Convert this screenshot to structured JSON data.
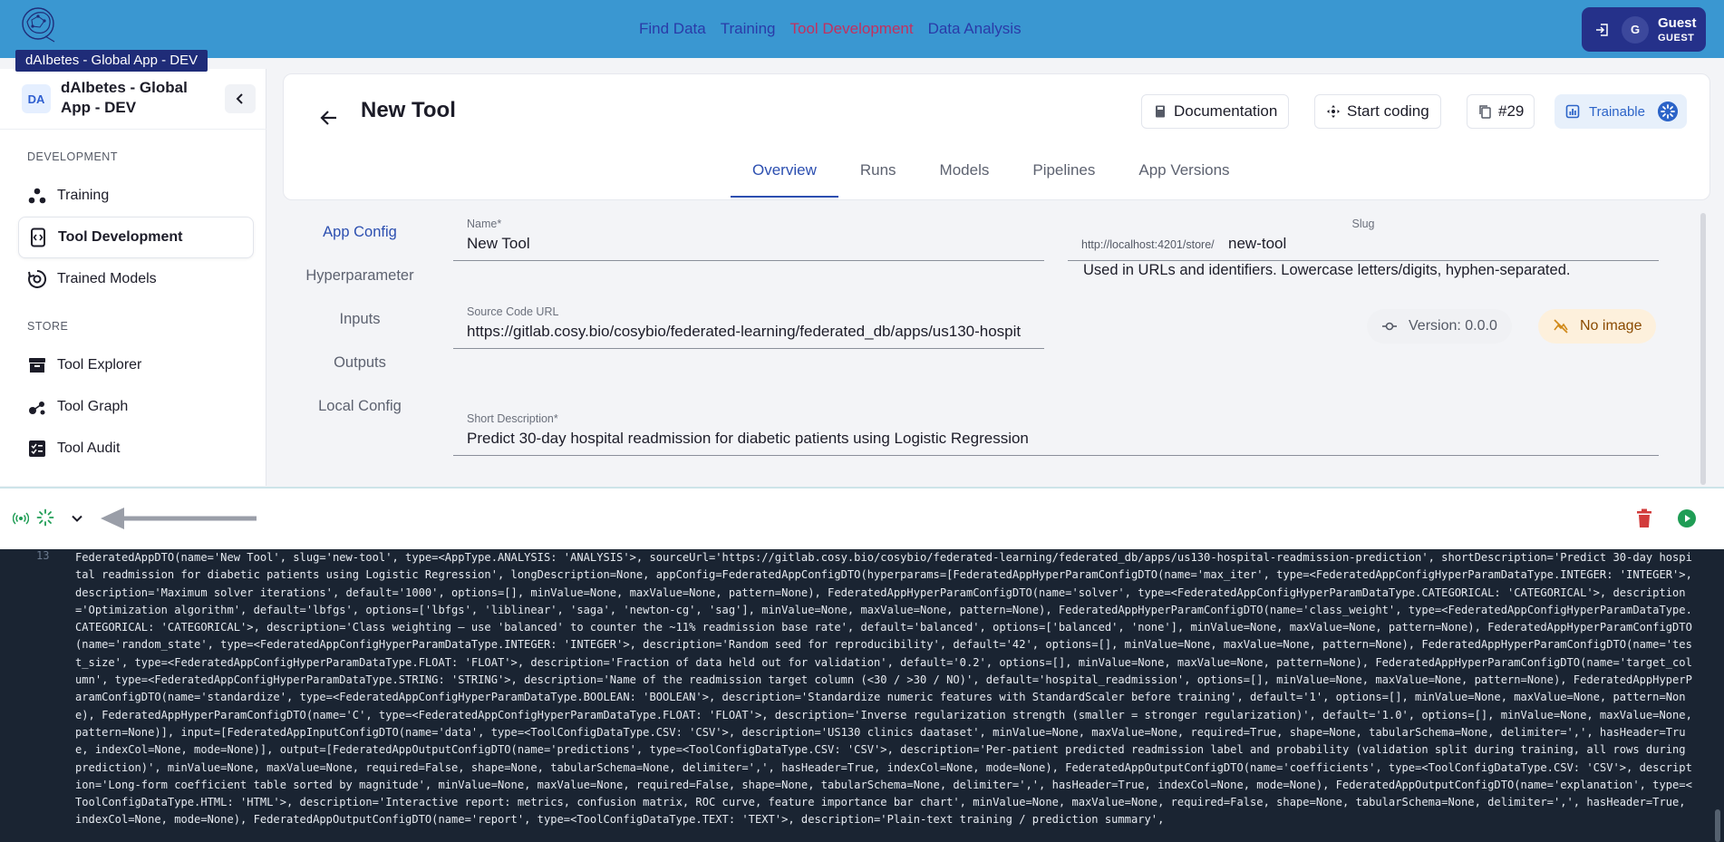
{
  "app": {
    "env_badge": "dAIbetes - Global App - DEV"
  },
  "topnav": [
    {
      "label": "Find Data",
      "active": false
    },
    {
      "label": "Training",
      "active": false
    },
    {
      "label": "Tool Development",
      "active": true
    },
    {
      "label": "Data Analysis",
      "active": false
    }
  ],
  "user": {
    "avatar_initial": "G",
    "name": "Guest",
    "role": "GUEST"
  },
  "sidebar": {
    "badge": "DA",
    "name": "dAIbetes - Global App - DEV",
    "sections": {
      "development": "DEVELOPMENT",
      "store": "STORE"
    },
    "items": [
      {
        "label": "Training",
        "icon": "training-icon"
      },
      {
        "label": "Tool Development",
        "icon": "tool-development-icon",
        "active": true
      },
      {
        "label": "Trained Models",
        "icon": "trained-models-icon"
      },
      {
        "label": "Tool Explorer",
        "icon": "tool-explorer-icon"
      },
      {
        "label": "Tool Graph",
        "icon": "tool-graph-icon"
      },
      {
        "label": "Tool Audit",
        "icon": "tool-audit-icon"
      }
    ]
  },
  "header": {
    "title": "New Tool",
    "documentation": "Documentation",
    "start_coding": "Start coding",
    "id": "#29",
    "trainable": "Trainable"
  },
  "tabs": [
    "Overview",
    "Runs",
    "Models",
    "Pipelines",
    "App Versions"
  ],
  "config_nav": [
    "App Config",
    "Hyperparameter",
    "Inputs",
    "Outputs",
    "Local Config"
  ],
  "form": {
    "name_label": "Name*",
    "name_value": "New Tool",
    "slug_label": "Slug",
    "slug_prefix": "http://localhost:4201/store/",
    "slug_value": "new-tool",
    "slug_hint": "Used in URLs and identifiers. Lowercase letters/digits, hyphen-separated.",
    "source_label": "Source Code URL",
    "source_value": "https://gitlab.cosy.bio/cosybio/federated-learning/federated_db/apps/us130-hospit",
    "version": "Version: 0.0.0",
    "no_image": "No image",
    "short_desc_label": "Short Description*",
    "short_desc_value": "Predict 30-day hospital readmission for diabetic patients using Logistic Regression"
  },
  "console": {
    "line_number": "13",
    "text": "FederatedAppDTO(name='New Tool', slug='new-tool', type=<AppType.ANALYSIS: 'ANALYSIS'>, sourceUrl='https://gitlab.cosy.bio/cosybio/federated-learning/federated_db/apps/us130-hospital-readmission-prediction', shortDescription='Predict 30-day hospital readmission for diabetic patients using Logistic Regression', longDescription=None, appConfig=FederatedAppConfigDTO(hyperparams=[FederatedAppHyperParamConfigDTO(name='max_iter', type=<FederatedAppConfigHyperParamDataType.INTEGER: 'INTEGER'>, description='Maximum solver iterations', default='1000', options=[], minValue=None, maxValue=None, pattern=None), FederatedAppHyperParamConfigDTO(name='solver', type=<FederatedAppConfigHyperParamDataType.CATEGORICAL: 'CATEGORICAL'>, description='Optimization algorithm', default='lbfgs', options=['lbfgs', 'liblinear', 'saga', 'newton-cg', 'sag'], minValue=None, maxValue=None, pattern=None), FederatedAppHyperParamConfigDTO(name='class_weight', type=<FederatedAppConfigHyperParamDataType.CATEGORICAL: 'CATEGORICAL'>, description='Class weighting — use 'balanced' to counter the ~11% readmission base rate', default='balanced', options=['balanced', 'none'], minValue=None, maxValue=None, pattern=None), FederatedAppHyperParamConfigDTO(name='random_state', type=<FederatedAppConfigHyperParamDataType.INTEGER: 'INTEGER'>, description='Random seed for reproducibility', default='42', options=[], minValue=None, maxValue=None, pattern=None), FederatedAppHyperParamConfigDTO(name='test_size', type=<FederatedAppConfigHyperParamDataType.FLOAT: 'FLOAT'>, description='Fraction of data held out for validation', default='0.2', options=[], minValue=None, maxValue=None, pattern=None), FederatedAppHyperParamConfigDTO(name='target_column', type=<FederatedAppConfigHyperParamDataType.STRING: 'STRING'>, description='Name of the readmission target column (<30 / >30 / NO)', default='hospital_readmission', options=[], minValue=None, maxValue=None, pattern=None), FederatedAppHyperParamConfigDTO(name='standardize', type=<FederatedAppConfigHyperParamDataType.BOOLEAN: 'BOOLEAN'>, description='Standardize numeric features with StandardScaler before training', default='1', options=[], minValue=None, maxValue=None, pattern=None), FederatedAppHyperParamConfigDTO(name='C', type=<FederatedAppConfigHyperParamDataType.FLOAT: 'FLOAT'>, description='Inverse regularization strength (smaller = stronger regularization)', default='1.0', options=[], minValue=None, maxValue=None, pattern=None)], input=[FederatedAppInputConfigDTO(name='data', type=<ToolConfigDataType.CSV: 'CSV'>, description='US130 clinics daataset', minValue=None, maxValue=None, required=True, shape=None, tabularSchema=None, delimiter=',', hasHeader=True, indexCol=None, mode=None)], output=[FederatedAppOutputConfigDTO(name='predictions', type=<ToolConfigDataType.CSV: 'CSV'>, description='Per-patient predicted readmission label and probability (validation split during training, all rows during prediction)', minValue=None, maxValue=None, required=False, shape=None, tabularSchema=None, delimiter=',', hasHeader=True, indexCol=None, mode=None), FederatedAppOutputConfigDTO(name='coefficients', type=<ToolConfigDataType.CSV: 'CSV'>, description='Long-form coefficient table sorted by magnitude', minValue=None, maxValue=None, required=False, shape=None, tabularSchema=None, delimiter=',', hasHeader=True, indexCol=None, mode=None), FederatedAppOutputConfigDTO(name='explanation', type=<ToolConfigDataType.HTML: 'HTML'>, description='Interactive report: metrics, confusion matrix, ROC curve, feature importance bar chart', minValue=None, maxValue=None, required=False, shape=None, tabularSchema=None, delimiter=',', hasHeader=True, indexCol=None, mode=None), FederatedAppOutputConfigDTO(name='report', type=<ToolConfigDataType.TEXT: 'TEXT'>, description='Plain-text training / prediction summary',"
  },
  "colors": {
    "topbar": "#3a97d1",
    "nav_link": "#2a3ba8",
    "nav_active": "#c3305f",
    "user_box": "#25318a",
    "accent": "#2c4fb0",
    "console_bg": "#1a2432",
    "run_green": "#1f9d55",
    "delete_red": "#d23b3b"
  }
}
